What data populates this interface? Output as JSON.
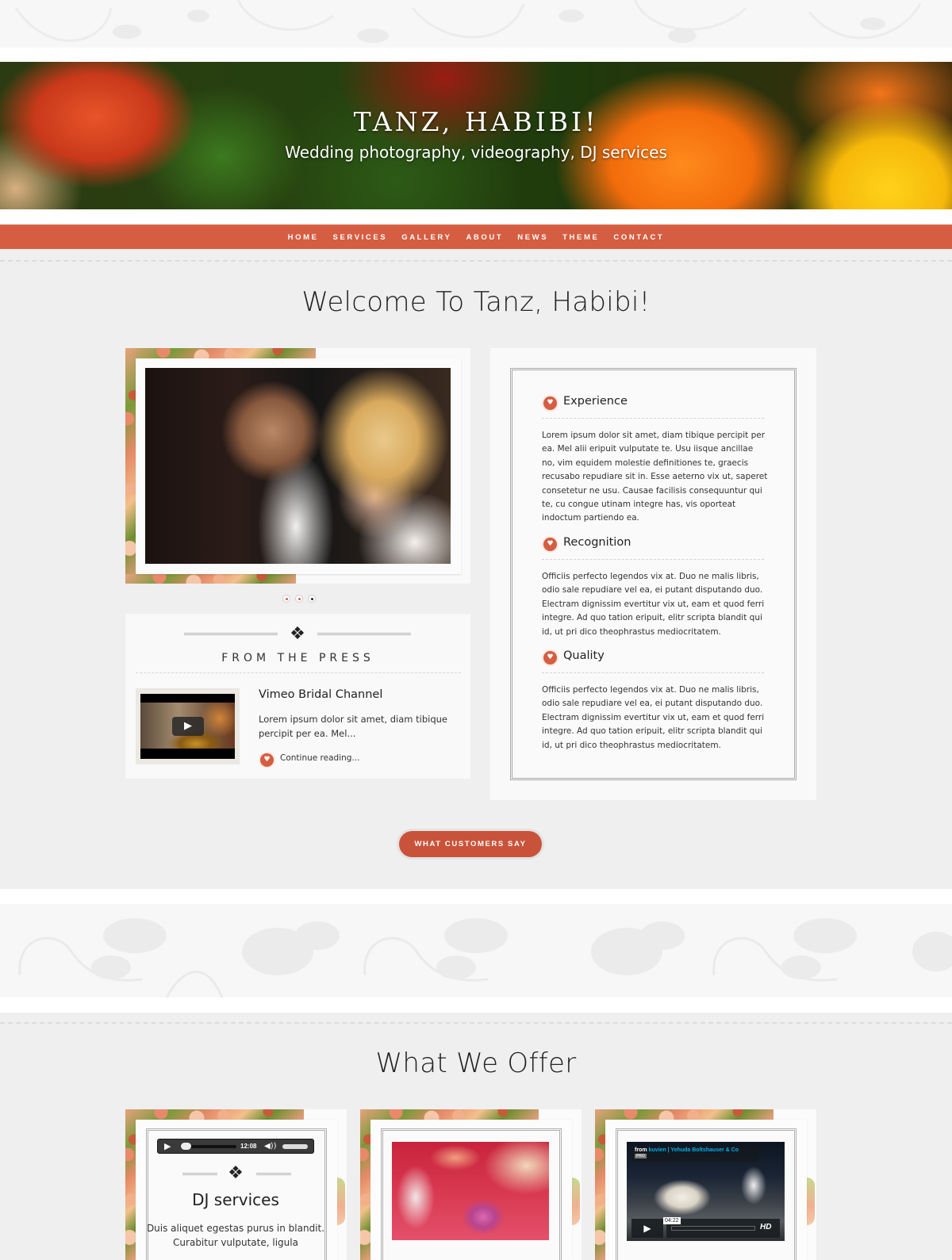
{
  "site": {
    "title": "TANZ, HABIBI!",
    "tagline_part1": "Wedding photography, videography, ",
    "tagline_part2": "DJ services"
  },
  "nav": {
    "items": [
      {
        "label": "HOME"
      },
      {
        "label": "SERVICES"
      },
      {
        "label": "GALLERY"
      },
      {
        "label": "ABOUT"
      },
      {
        "label": "NEWS"
      },
      {
        "label": "THEME"
      },
      {
        "label": "CONTACT"
      }
    ]
  },
  "colors": {
    "accent": "#d45d42",
    "button": "#c9533a",
    "background": "#efefef",
    "vimeo_link": "#00adef"
  },
  "welcome": {
    "title": "Welcome To Tanz, Habibi!",
    "slider": {
      "slide_count": 3,
      "active_index": 3,
      "image_alt": "wedding-couple-photo"
    }
  },
  "press": {
    "title": "FROM THE PRESS",
    "item": {
      "headline": "Vimeo Bridal Channel",
      "excerpt": "Lorem ipsum dolor sit amet, diam tibique percipit per ea. Mel...",
      "link_label": "Continue reading..."
    }
  },
  "features": [
    {
      "heading": "Experience",
      "body": "Lorem ipsum dolor sit amet, diam tibique percipit per ea. Mel alii eripuit vulputate te. Usu iisque ancillae no, vim equidem molestie definitiones te, graecis recusabo repudiare sit in. Esse aeterno vix ut, saperet consetetur ne usu. Causae facilisis consequuntur qui te, cu congue utinam integre has, vis oporteat indoctum partiendo ea."
    },
    {
      "heading": "Recognition",
      "body": "Officiis perfecto legendos vix at. Duo ne malis libris, odio sale repudiare vel ea, ei putant disputando duo. Electram dignissim evertitur vix ut, eam et quod ferri integre. Ad quo tation eripuit, elitr scripta blandit qui id, ut pri dico theophrastus mediocritatem."
    },
    {
      "heading": "Quality",
      "body": "Officiis perfecto legendos vix at. Duo ne malis libris, odio sale repudiare vel ea, ei putant disputando duo. Electram dignissim evertitur vix ut, eam et quod ferri integre. Ad quo tation eripuit, elitr scripta blandit qui id, ut pri dico theophrastus mediocritatem."
    }
  ],
  "cta": {
    "label": "WHAT CUSTOMERS SAY"
  },
  "offer": {
    "title": "What We Offer",
    "cards": [
      {
        "title": "DJ services",
        "text": "Duis aliquet egestas purus in blandit. Curabitur vulputate, ligula",
        "player": {
          "play_icon": "▶",
          "time": "12:08",
          "volume_icon": "🔊"
        }
      },
      {
        "image_alt": "wedding-table-glasses-photo"
      },
      {
        "video": {
          "from_label": "from",
          "author": "kuvien | Yehuda Boltshauser & Co",
          "badge": "PRO",
          "time": "04:22",
          "hd_label": "HD"
        }
      }
    ]
  }
}
